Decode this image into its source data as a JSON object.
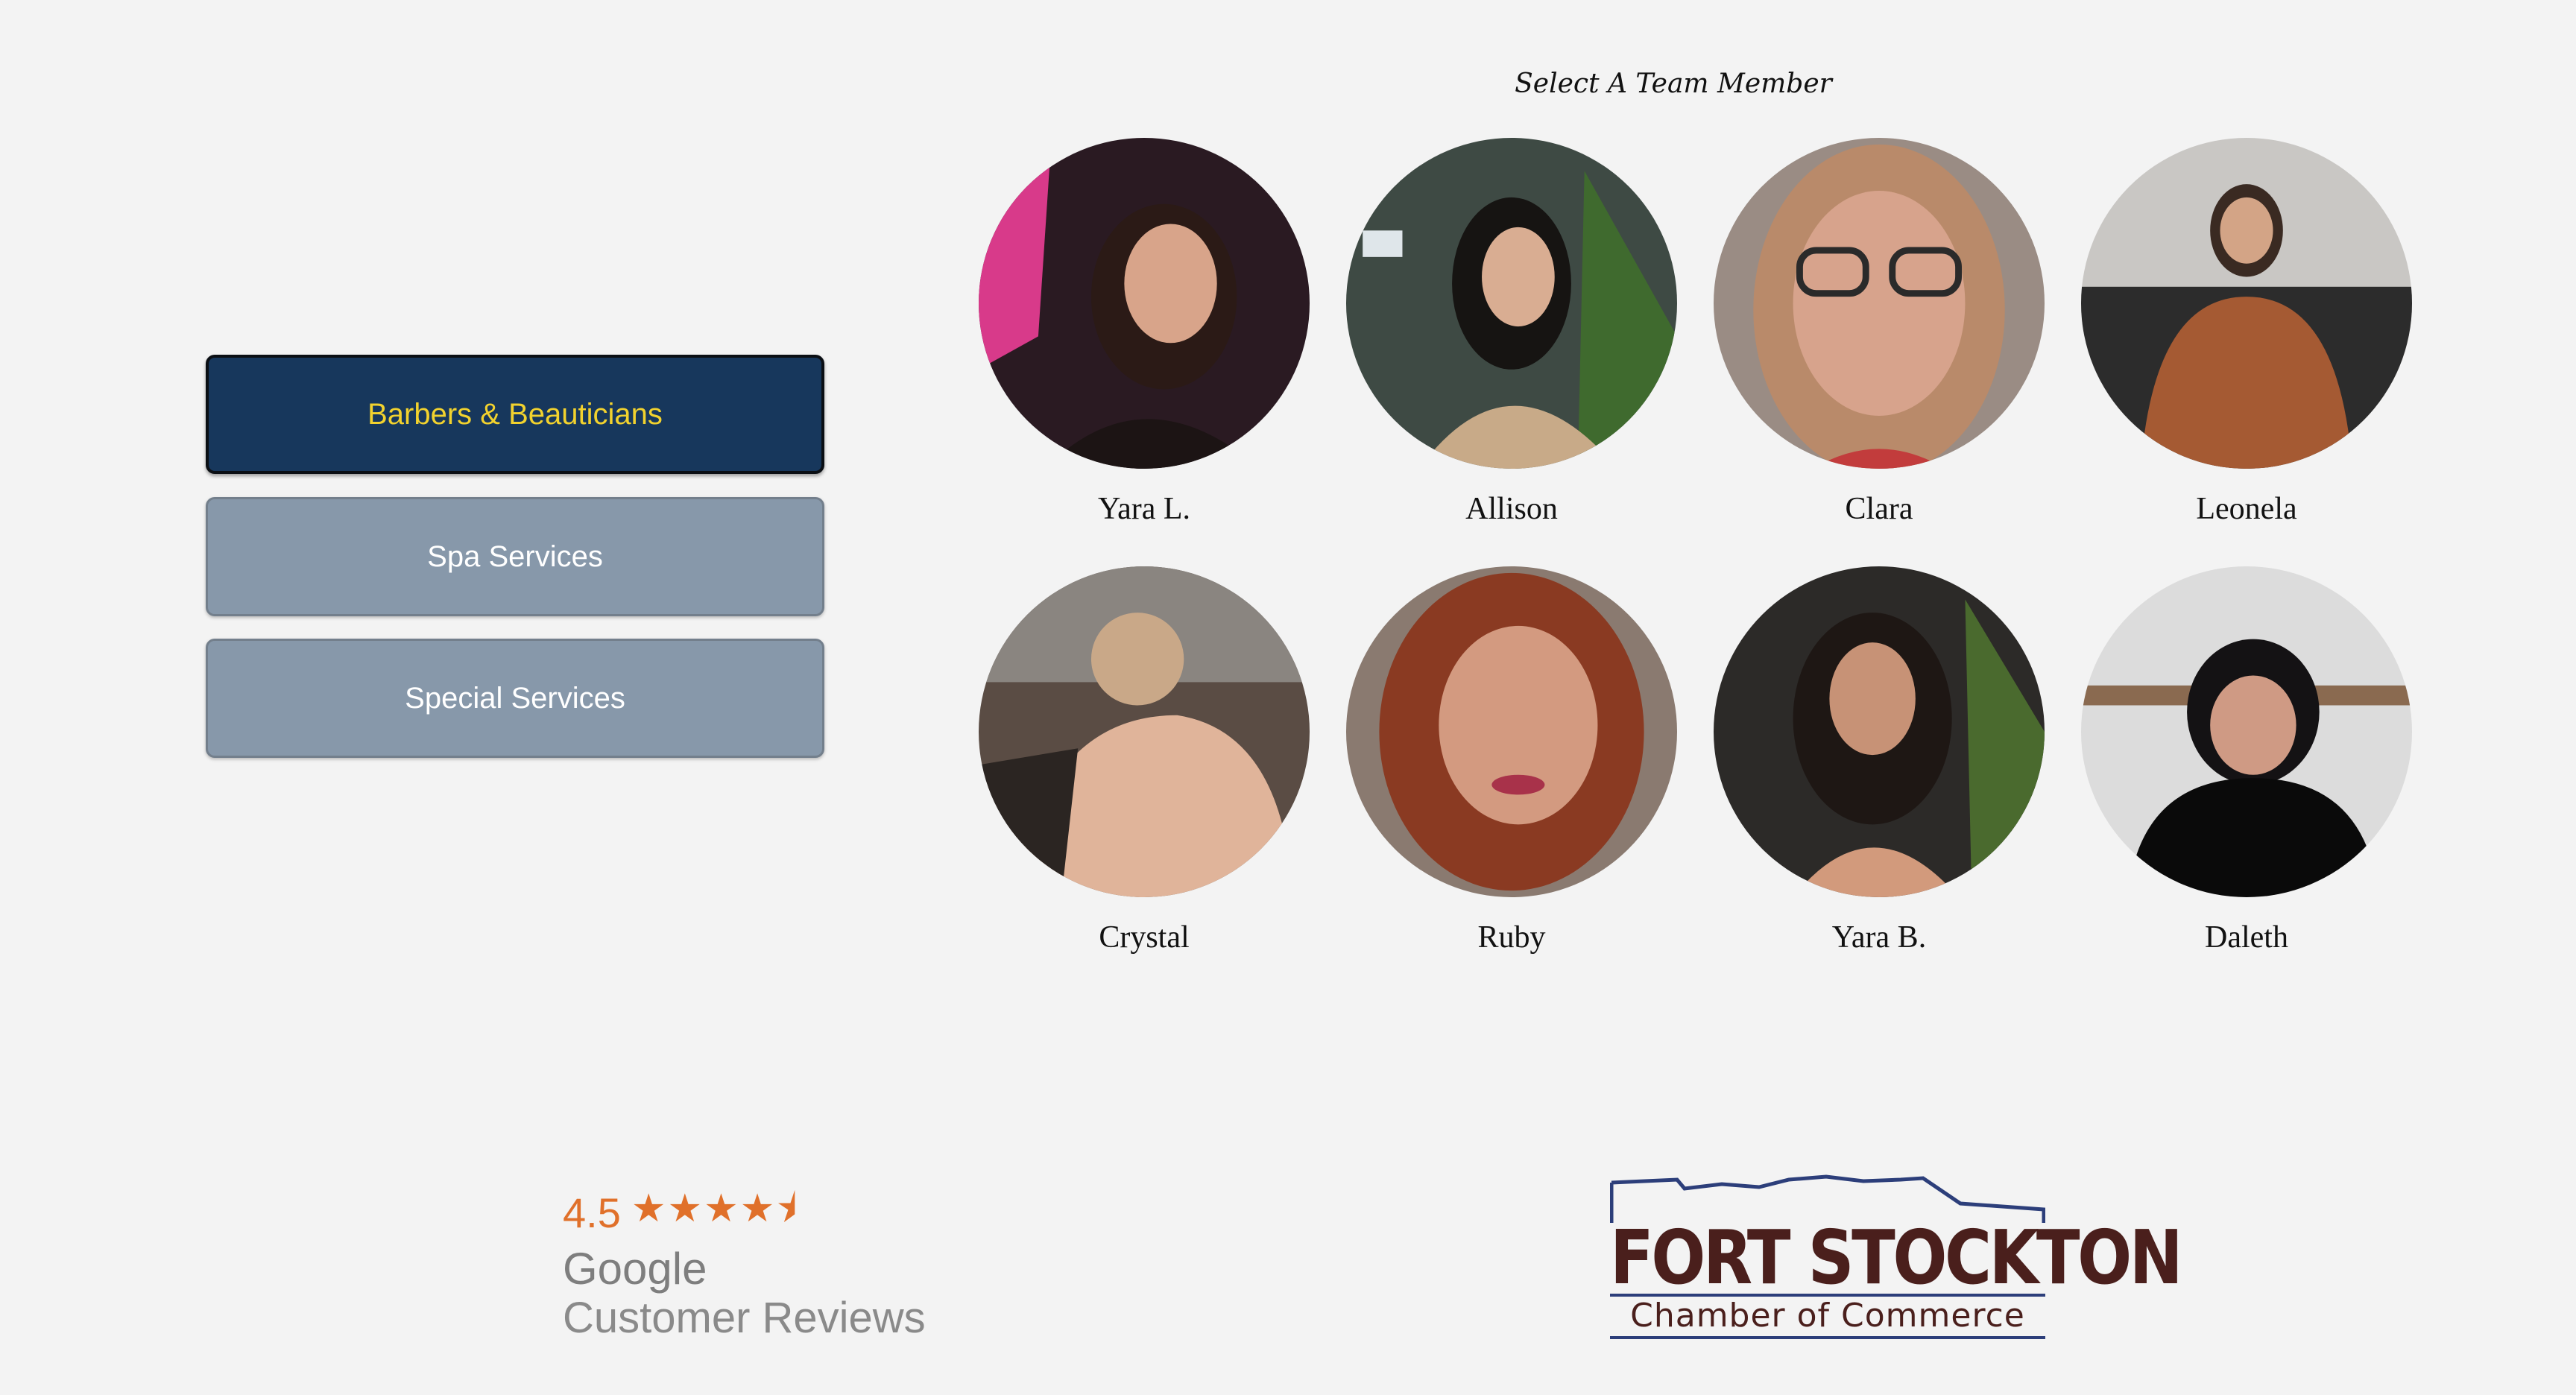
{
  "categories": [
    {
      "label": "Barbers & Beauticians",
      "active": true
    },
    {
      "label": "Spa Services",
      "active": false
    },
    {
      "label": "Special Services",
      "active": false
    }
  ],
  "team": {
    "heading": "Select A Team Member",
    "members": [
      {
        "name": "Yara L."
      },
      {
        "name": "Allison"
      },
      {
        "name": "Clara"
      },
      {
        "name": "Leonela"
      },
      {
        "name": "Crystal"
      },
      {
        "name": "Ruby"
      },
      {
        "name": "Yara B."
      },
      {
        "name": "Daleth"
      }
    ]
  },
  "reviews": {
    "rating": "4.5",
    "stars": "★★★★⯨",
    "brand": "Google",
    "subtitle": "Customer Reviews"
  },
  "chamber": {
    "title": "FORT STOCKTON",
    "subtitle": "Chamber of Commerce"
  },
  "colors": {
    "active_bg": "#17375c",
    "active_text": "#f2d22e",
    "inactive_bg": "#8798aa",
    "star_orange": "#e0702a",
    "chamber_brown": "#4a1f1c",
    "chamber_blue": "#2c3e7a"
  }
}
